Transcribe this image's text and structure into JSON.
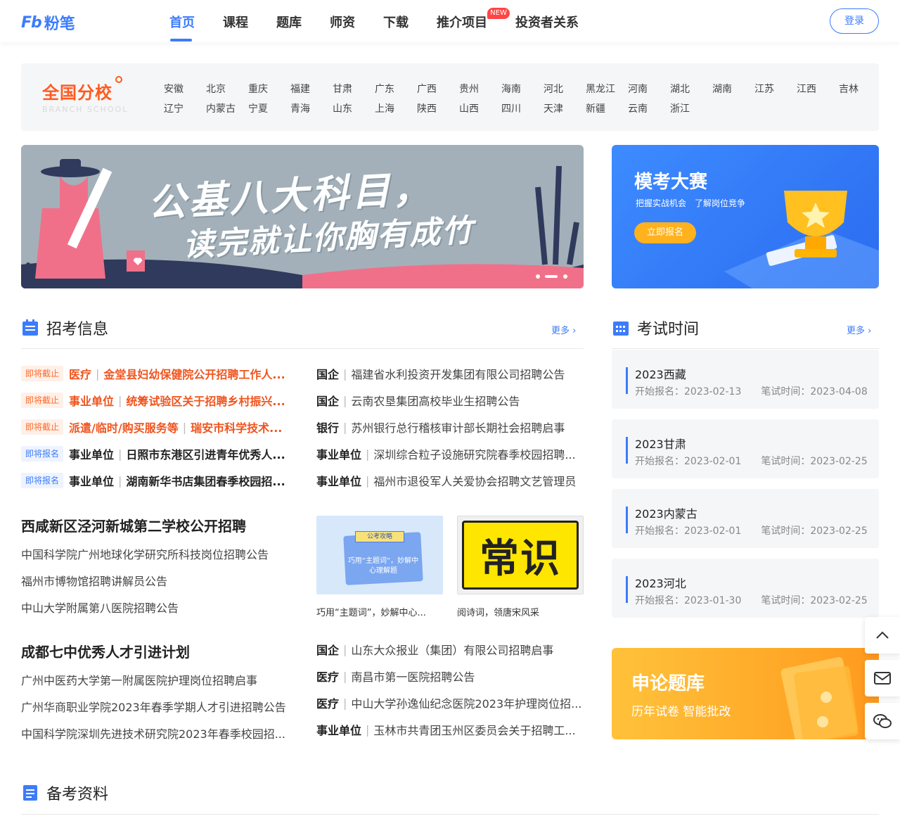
{
  "header": {
    "logo_mark": "Fb",
    "logo_text": "粉笔",
    "nav": [
      "首页",
      "课程",
      "题库",
      "师资",
      "下载",
      "推介项目",
      "投资者关系"
    ],
    "new_badge": "NEW",
    "login": "登录"
  },
  "branch": {
    "title": "全国分校",
    "subtitle": "BRANCH SCHOOL",
    "provinces_row1": [
      "安徽",
      "北京",
      "重庆",
      "福建",
      "甘肃",
      "广东",
      "广西",
      "贵州",
      "海南",
      "河北",
      "黑龙江",
      "河南",
      "湖北",
      "湖南",
      "江苏",
      "江西",
      "吉林"
    ],
    "provinces_row2": [
      "辽宁",
      "内蒙古",
      "宁夏",
      "青海",
      "山东",
      "上海",
      "陕西",
      "山西",
      "四川",
      "天津",
      "新疆",
      "云南",
      "浙江"
    ]
  },
  "banner": {
    "line1": "公基八大科目，",
    "line2": "读完就让你胸有成竹"
  },
  "mokao": {
    "title": "模考大赛",
    "subtitle": "把握实战机会　了解岗位竞争",
    "button": "立即报名"
  },
  "recruit": {
    "title": "招考信息",
    "more": "更多",
    "left_items": [
      {
        "tag": "即将截止",
        "tag_type": "hot",
        "category": "医疗",
        "title": "金堂县妇幼保健院公开招聘工作人..."
      },
      {
        "tag": "即将截止",
        "tag_type": "hot",
        "category": "事业单位",
        "title": "统筹试验区关于招聘乡村振兴..."
      },
      {
        "tag": "即将截止",
        "tag_type": "hot",
        "category": "派遣/临时/购买服务等",
        "title": "瑞安市科学技术..."
      },
      {
        "tag": "即将报名",
        "tag_type": "sign",
        "category": "事业单位",
        "title": "日照市东港区引进青年优秀人..."
      },
      {
        "tag": "即将报名",
        "tag_type": "sign",
        "category": "事业单位",
        "title": "湖南新华书店集团春季校园招..."
      }
    ],
    "right_items": [
      {
        "category": "国企",
        "title": "福建省水利投资开发集团有限公司招聘公告"
      },
      {
        "category": "国企",
        "title": "云南农垦集团高校毕业生招聘公告"
      },
      {
        "category": "银行",
        "title": "苏州银行总行稽核审计部长期社会招聘启事"
      },
      {
        "category": "事业单位",
        "title": "深圳综合粒子设施研究院春季校园招聘..."
      },
      {
        "category": "事业单位",
        "title": "福州市退役军人关爱协会招聘文艺管理员"
      }
    ],
    "block1_title": "西咸新区泾河新城第二学校公开招聘",
    "block1_links": [
      "中国科学院广州地球化学研究所科技岗位招聘公告",
      "福州市博物馆招聘讲解员公告",
      "中山大学附属第八医院招聘公告"
    ],
    "thumb1_banner": "公考攻略",
    "thumb1_text": "巧用“主题词”，妙解中心理解题",
    "thumb1_caption": "巧用“主题词”，妙解中心...",
    "thumb2_text": "常识",
    "thumb2_caption": "阅诗词，领唐宋风采",
    "block2_title": "成都七中优秀人才引进计划",
    "block2_links": [
      "广州中医药大学第一附属医院护理岗位招聘启事",
      "广州华商职业学院2023年春季学期人才引进招聘公告",
      "中国科学院深圳先进技术研究院2023年春季校园招..."
    ],
    "block2_items": [
      {
        "category": "国企",
        "title": "山东大众报业（集团）有限公司招聘启事"
      },
      {
        "category": "医疗",
        "title": "南昌市第一医院招聘公告"
      },
      {
        "category": "医疗",
        "title": "中山大学孙逸仙纪念医院2023年护理岗位招..."
      },
      {
        "category": "事业单位",
        "title": "玉林市共青团玉州区委员会关于招聘工..."
      }
    ]
  },
  "exam_time": {
    "title": "考试时间",
    "more": "更多",
    "items": [
      {
        "name": "2023西藏",
        "dates": "开始报名：2023-02-13　　笔试时间：2023-04-08"
      },
      {
        "name": "2023甘肃",
        "dates": "开始报名：2023-02-01　　笔试时间：2023-02-25"
      },
      {
        "name": "2023内蒙古",
        "dates": "开始报名：2023-02-01　　笔试时间：2023-02-25"
      },
      {
        "name": "2023河北",
        "dates": "开始报名：2023-01-30　　笔试时间：2023-02-25"
      }
    ]
  },
  "shenlun": {
    "title": "申论题库",
    "subtitle": "历年试卷 智能批改"
  },
  "prep": {
    "title": "备考资料"
  },
  "colors": {
    "brand": "#3c7cfc",
    "hot": "#f0541e",
    "accent": "#ffb21e"
  }
}
